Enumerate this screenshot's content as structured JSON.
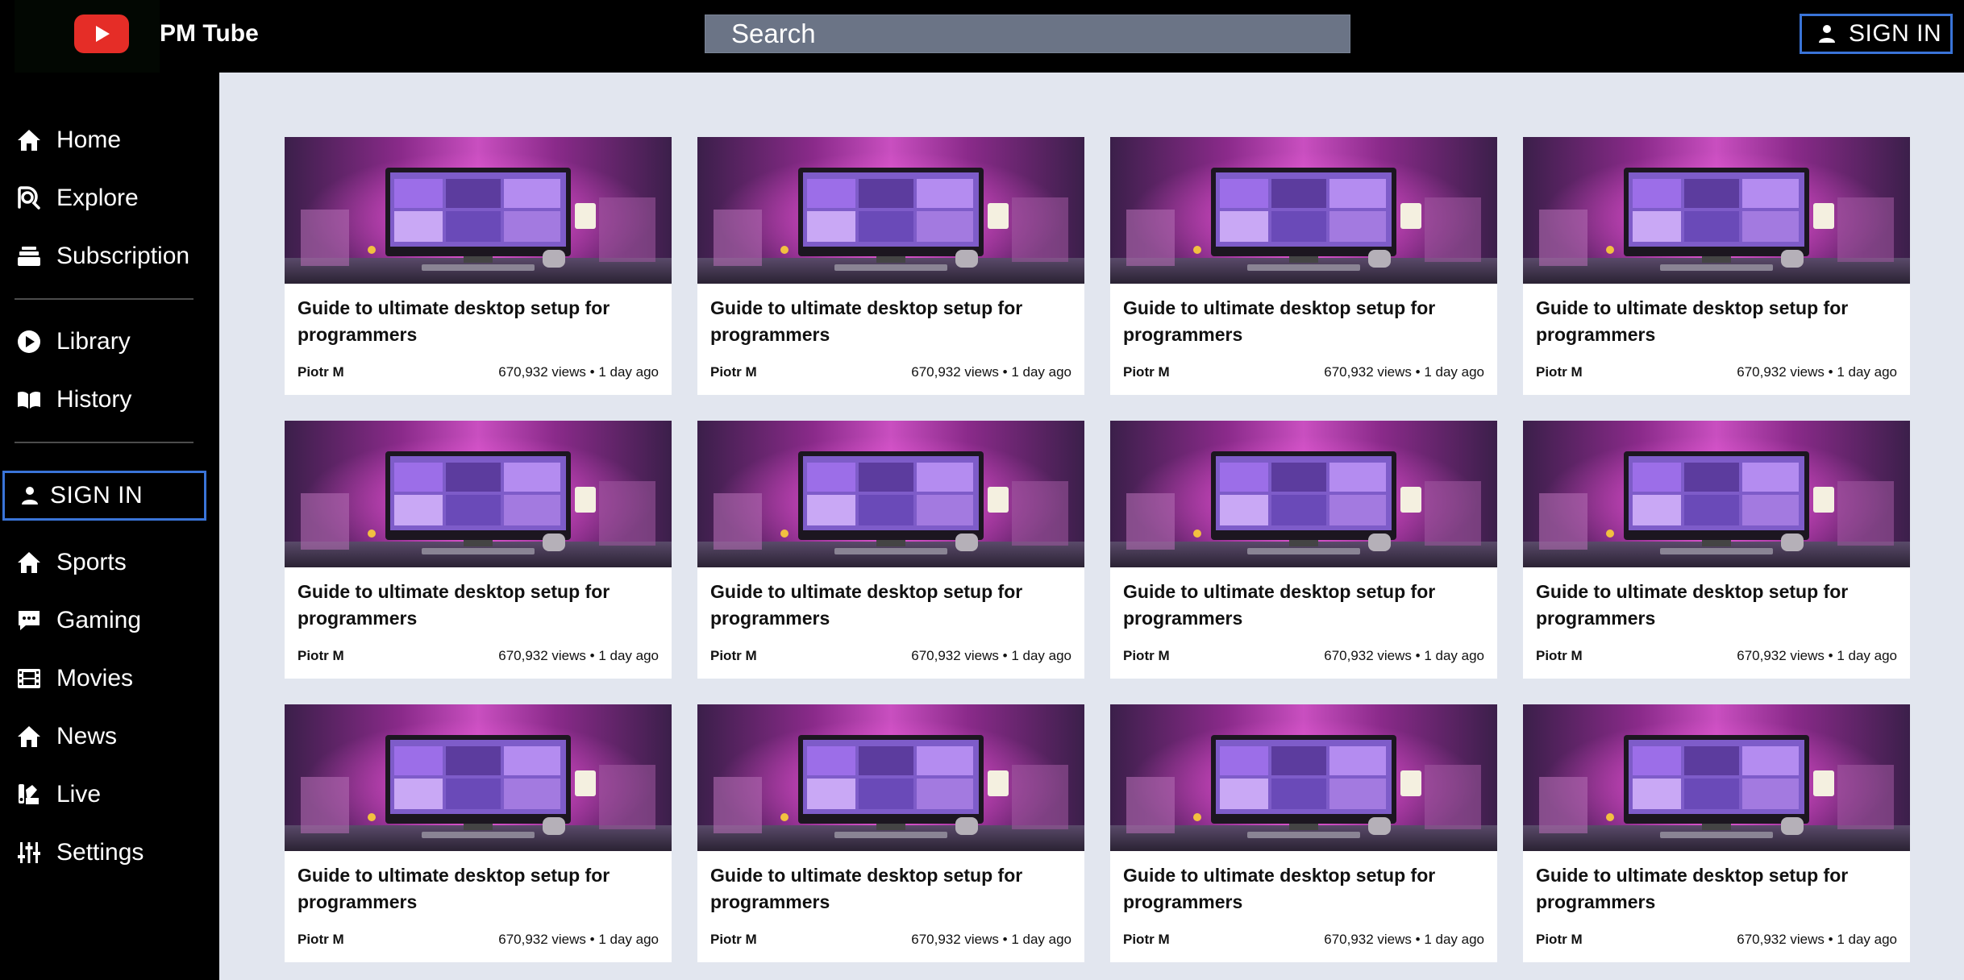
{
  "app": {
    "title": "PM Tube"
  },
  "header": {
    "search_placeholder": "Search",
    "signin_label": "SIGN IN"
  },
  "sidebar": {
    "primary": [
      {
        "label": "Home",
        "icon": "home-icon"
      },
      {
        "label": "Explore",
        "icon": "explore-icon"
      },
      {
        "label": "Subscription",
        "icon": "subscription-icon"
      }
    ],
    "secondary": [
      {
        "label": "Library",
        "icon": "library-icon"
      },
      {
        "label": "History",
        "icon": "history-icon"
      }
    ],
    "signin_label": "SIGN IN",
    "categories": [
      {
        "label": "Sports",
        "icon": "sports-icon"
      },
      {
        "label": "Gaming",
        "icon": "gaming-icon"
      },
      {
        "label": "Movies",
        "icon": "movies-icon"
      },
      {
        "label": "News",
        "icon": "news-icon"
      },
      {
        "label": "Live",
        "icon": "live-icon"
      },
      {
        "label": "Settings",
        "icon": "settings-icon"
      }
    ]
  },
  "videos": [
    {
      "title": "Guide to ultimate desktop setup for programmers",
      "author": "Piotr M",
      "meta": "670,932 views • 1 day ago"
    },
    {
      "title": "Guide to ultimate desktop setup for programmers",
      "author": "Piotr M",
      "meta": "670,932 views • 1 day ago"
    },
    {
      "title": "Guide to ultimate desktop setup for programmers",
      "author": "Piotr M",
      "meta": "670,932 views • 1 day ago"
    },
    {
      "title": "Guide to ultimate desktop setup for programmers",
      "author": "Piotr M",
      "meta": "670,932 views • 1 day ago"
    },
    {
      "title": "Guide to ultimate desktop setup for programmers",
      "author": "Piotr M",
      "meta": "670,932 views • 1 day ago"
    },
    {
      "title": "Guide to ultimate desktop setup for programmers",
      "author": "Piotr M",
      "meta": "670,932 views • 1 day ago"
    },
    {
      "title": "Guide to ultimate desktop setup for programmers",
      "author": "Piotr M",
      "meta": "670,932 views • 1 day ago"
    },
    {
      "title": "Guide to ultimate desktop setup for programmers",
      "author": "Piotr M",
      "meta": "670,932 views • 1 day ago"
    },
    {
      "title": "Guide to ultimate desktop setup for programmers",
      "author": "Piotr M",
      "meta": "670,932 views • 1 day ago"
    },
    {
      "title": "Guide to ultimate desktop setup for programmers",
      "author": "Piotr M",
      "meta": "670,932 views • 1 day ago"
    },
    {
      "title": "Guide to ultimate desktop setup for programmers",
      "author": "Piotr M",
      "meta": "670,932 views • 1 day ago"
    },
    {
      "title": "Guide to ultimate desktop setup for programmers",
      "author": "Piotr M",
      "meta": "670,932 views • 1 day ago"
    }
  ],
  "colors": {
    "accent": "#3a74d8",
    "logo_red": "#e52d27",
    "background": "#e2e6ef",
    "sidebar": "#000000",
    "search_bg": "#6b7486"
  }
}
